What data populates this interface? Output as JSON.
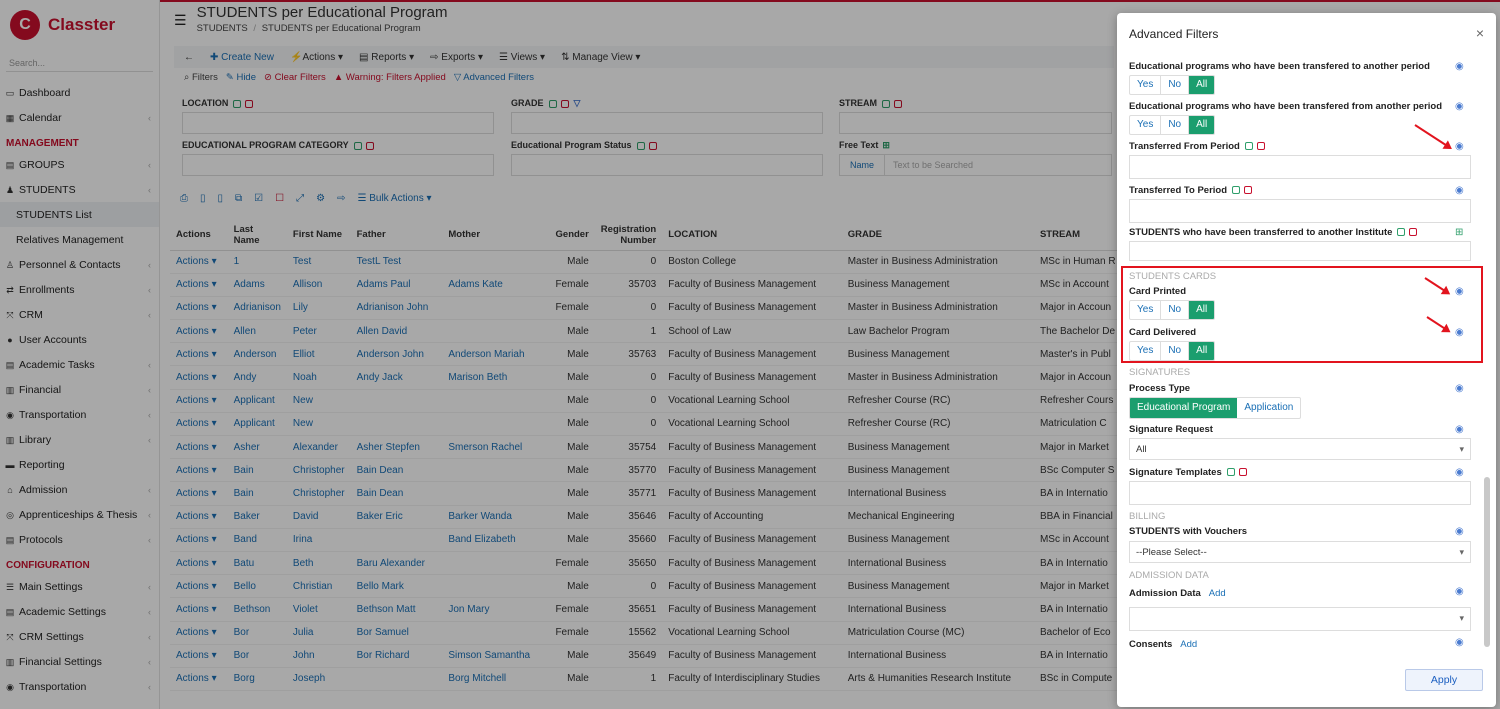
{
  "app": {
    "logo": "Classter",
    "logo_mark": "C"
  },
  "sidebar": {
    "search_placeholder": "Search...",
    "items": [
      {
        "label": "Dashboard",
        "icon": "monitor-icon"
      },
      {
        "label": "Calendar",
        "icon": "calendar-icon"
      },
      {
        "label": "MANAGEMENT",
        "section": true
      },
      {
        "label": "GROUPS",
        "icon": "groups-icon"
      },
      {
        "label": "STUDENTS",
        "icon": "students-icon"
      },
      {
        "label": "STUDENTS List",
        "sub": true,
        "active": true
      },
      {
        "label": "Relatives Management",
        "sub": true
      },
      {
        "label": "Personnel & Contacts",
        "icon": "personnel-icon"
      },
      {
        "label": "Enrollments",
        "icon": "enroll-icon"
      },
      {
        "label": "CRM",
        "icon": "crm-icon"
      },
      {
        "label": "User Accounts",
        "icon": "user-icon"
      },
      {
        "label": "Academic Tasks",
        "icon": "tasks-icon"
      },
      {
        "label": "Financial",
        "icon": "financial-icon"
      },
      {
        "label": "Transportation",
        "icon": "bus-icon"
      },
      {
        "label": "Library",
        "icon": "library-icon"
      },
      {
        "label": "Reporting",
        "icon": "reporting-icon"
      },
      {
        "label": "Admission",
        "icon": "admission-icon"
      },
      {
        "label": "Apprenticeships & Thesis",
        "icon": "thesis-icon"
      },
      {
        "label": "Protocols",
        "icon": "protocols-icon"
      },
      {
        "label": "CONFIGURATION",
        "section": true
      },
      {
        "label": "Main Settings",
        "icon": "settings-icon"
      },
      {
        "label": "Academic Settings",
        "icon": "academic-settings-icon"
      },
      {
        "label": "CRM Settings",
        "icon": "crm-settings-icon"
      },
      {
        "label": "Financial Settings",
        "icon": "financial-settings-icon"
      },
      {
        "label": "Transportation",
        "icon": "bus-icon"
      }
    ]
  },
  "header": {
    "title": "STUDENTS per Educational Program",
    "breadcrumb_1": "STUDENTS",
    "breadcrumb_sep": "/",
    "breadcrumb_2": "STUDENTS per Educational Program"
  },
  "toolbar": {
    "create": "Create New",
    "actions": "Actions",
    "reports": "Reports",
    "exports": "Exports",
    "views": "Views",
    "manage_view": "Manage View"
  },
  "filterbar": {
    "filters": "Filters",
    "hide": "Hide",
    "clear": "Clear Filters",
    "warning": "Warning: Filters Applied",
    "advanced": "Advanced Filters"
  },
  "filters": {
    "location": "LOCATION",
    "grade": "GRADE",
    "stream": "STREAM",
    "ep_category": "EDUCATIONAL PROGRAM CATEGORY",
    "ep_status": "Educational Program Status",
    "free_text": "Free Text",
    "name_label": "Name",
    "free_text_placeholder": "Text to be Searched"
  },
  "bulk": {
    "label": "Bulk Actions"
  },
  "table": {
    "headers": [
      "Actions",
      "Last Name",
      "First Name",
      "Father",
      "Mother",
      "Gender",
      "Registration Number",
      "LOCATION",
      "GRADE",
      "STREAM"
    ],
    "action_label": "Actions ▾",
    "rows": [
      [
        "1",
        "Test",
        "TestL Test",
        "",
        "Male",
        "0",
        "Boston College",
        "Master in Business Administration",
        "MSc in Human R"
      ],
      [
        "Adams",
        "Allison",
        "Adams Paul",
        "Adams Kate",
        "Female",
        "35703",
        "Faculty of Business Management",
        "Business Management",
        "MSc in Account"
      ],
      [
        "Adrianison",
        "Lily",
        "Adrianison John",
        "",
        "Female",
        "0",
        "Faculty of Business Management",
        "Master in Business Administration",
        "Major in Accoun"
      ],
      [
        "Allen",
        "Peter",
        "Allen David",
        "",
        "Male",
        "1",
        "School of Law",
        "Law Bachelor Program",
        "The Bachelor De"
      ],
      [
        "Anderson",
        "Elliot",
        "Anderson John",
        "Anderson Mariah",
        "Male",
        "35763",
        "Faculty of Business Management",
        "Business Management",
        "Master's in Publ"
      ],
      [
        "Andy",
        "Noah",
        "Andy Jack",
        "Marison Beth",
        "Male",
        "0",
        "Faculty of Business Management",
        "Master in Business Administration",
        "Major in Accoun"
      ],
      [
        "Applicant",
        "New",
        "",
        "",
        "Male",
        "0",
        "Vocational Learning School",
        "Refresher Course (RC)",
        "Refresher Cours"
      ],
      [
        "Applicant",
        "New",
        "",
        "",
        "Male",
        "0",
        "Vocational Learning School",
        "Refresher Course (RC)",
        "Matriculation C"
      ],
      [
        "Asher",
        "Alexander",
        "Asher Stepfen",
        "Smerson Rachel",
        "Male",
        "35754",
        "Faculty of Business Management",
        "Business Management",
        "Major in Market"
      ],
      [
        "Bain",
        "Christopher",
        "Bain Dean",
        "",
        "Male",
        "35770",
        "Faculty of Business Management",
        "Business Management",
        "BSc Computer S"
      ],
      [
        "Bain",
        "Christopher",
        "Bain Dean",
        "",
        "Male",
        "35771",
        "Faculty of Business Management",
        "International Business",
        "BA in Internatio"
      ],
      [
        "Baker",
        "David",
        "Baker Eric",
        "Barker Wanda",
        "Male",
        "35646",
        "Faculty of Accounting",
        "Mechanical Engineering",
        "BBA in Financial"
      ],
      [
        "Band",
        "Irina",
        "",
        "Band Elizabeth",
        "Male",
        "35660",
        "Faculty of Business Management",
        "Business Management",
        "MSc in Account"
      ],
      [
        "Batu",
        "Beth",
        "Baru Alexander",
        "",
        "Female",
        "35650",
        "Faculty of Business Management",
        "International Business",
        "BA in Internatio"
      ],
      [
        "Bello",
        "Christian",
        "Bello Mark",
        "",
        "Male",
        "0",
        "Faculty of Business Management",
        "Business Management",
        "Major in Market"
      ],
      [
        "Bethson",
        "Violet",
        "Bethson Matt",
        "Jon Mary",
        "Female",
        "35651",
        "Faculty of Business Management",
        "International Business",
        "BA in Internatio"
      ],
      [
        "Bor",
        "Julia",
        "Bor Samuel",
        "",
        "Female",
        "15562",
        "Vocational Learning School",
        "Matriculation Course (MC)",
        "Bachelor of Eco"
      ],
      [
        "Bor",
        "John",
        "Bor Richard",
        "Simson Samantha",
        "Male",
        "35649",
        "Faculty of Business Management",
        "International Business",
        "BA in Internatio"
      ],
      [
        "Borg",
        "Joseph",
        "",
        "Borg Mitchell",
        "Male",
        "1",
        "Faculty of Interdisciplinary Studies",
        "Arts & Humanities Research Institute",
        "BSc in Compute"
      ]
    ]
  },
  "modal": {
    "title": "Advanced Filters",
    "close": "×",
    "yes": "Yes",
    "no": "No",
    "all": "All",
    "f1": "Educational programs who have been transfered to another period",
    "f2": "Educational programs who have been transfered from another period",
    "f3": "Transferred From Period",
    "f4": "Transferred To Period",
    "f5": "STUDENTS who have been transferred to another Institute",
    "sect_cards": "STUDENTS CARDS",
    "card_printed": "Card Printed",
    "card_delivered": "Card Delivered",
    "sect_signatures": "SIGNATURES",
    "process_type": "Process Type",
    "pt_ep": "Educational Program",
    "pt_app": "Application",
    "sig_request": "Signature Request",
    "sig_request_value": "All",
    "sig_templates": "Signature Templates",
    "sect_billing": "BILLING",
    "vouchers": "STUDENTS with Vouchers",
    "vouchers_value": "--Please Select--",
    "sect_admission": "ADMISSION DATA",
    "admission_data": "Admission Data",
    "add": "Add",
    "consents": "Consents",
    "apply": "Apply"
  }
}
